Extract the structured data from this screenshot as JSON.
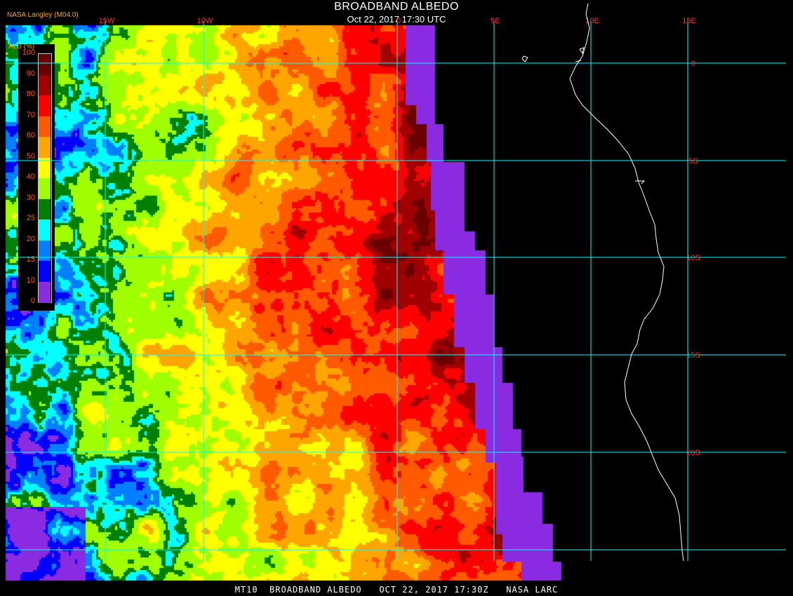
{
  "title": "BROADBAND ALBEDO",
  "subtitle": "Oct 22, 2017 17:30 UTC",
  "credit": "NASA Langley (M04.0)",
  "footer": "MT10  BROADBAND ALBEDO   OCT 22, 2017 17:30Z   NASA LARC",
  "legend": {
    "title": "ALB (%)",
    "labels": [
      "100",
      "90",
      "80",
      "70",
      "60",
      "50",
      "40",
      "30",
      "25",
      "20",
      "15",
      "10",
      "0"
    ],
    "colors": [
      "#6b0000",
      "#a00000",
      "#ff0000",
      "#ff5a00",
      "#ffa500",
      "#ffff00",
      "#a0ff00",
      "#008000",
      "#00ffff",
      "#0080ff",
      "#0000ff",
      "#8a2be2"
    ]
  },
  "longitude_labels": [
    "15W",
    "10W",
    "0",
    "5E",
    "10E",
    "15E"
  ],
  "latitude_labels": [
    "0",
    "5S",
    "10S",
    "15S",
    "20S"
  ],
  "colors": {
    "grid": "#00ffff",
    "axis_label": "#ff3030",
    "coastline": "#ffffff",
    "no_data": "#8a2be2",
    "background": "#000000"
  }
}
